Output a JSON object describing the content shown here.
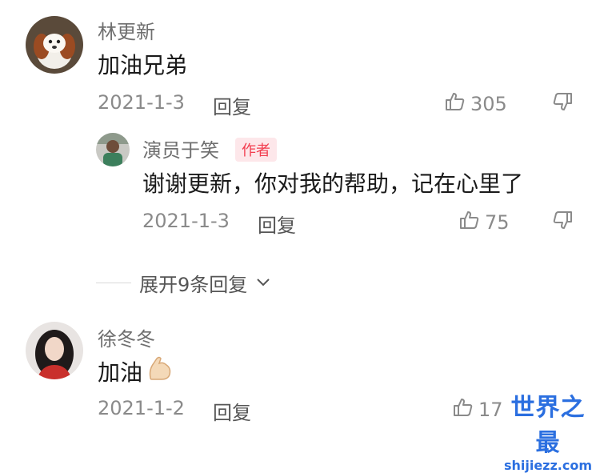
{
  "comments": [
    {
      "author": "林更新",
      "text": "加油兄弟",
      "date": "2021-1-3",
      "reply_label": "回复",
      "likes": "305"
    },
    {
      "author": "徐冬冬",
      "text": "加油",
      "date": "2021-1-2",
      "reply_label": "回复",
      "likes": "17"
    }
  ],
  "reply": {
    "author": "演员于笑",
    "badge": "作者",
    "text": "谢谢更新，你对我的帮助，记在心里了",
    "date": "2021-1-3",
    "reply_label": "回复",
    "likes": "75"
  },
  "expand_label": "展开9条回复",
  "watermark": {
    "title": "世界之最",
    "url": "shijiezz.com"
  },
  "colors": {
    "badge_bg": "#fde7ea",
    "badge_text": "#f23d4f",
    "watermark": "#2b6fe0"
  }
}
